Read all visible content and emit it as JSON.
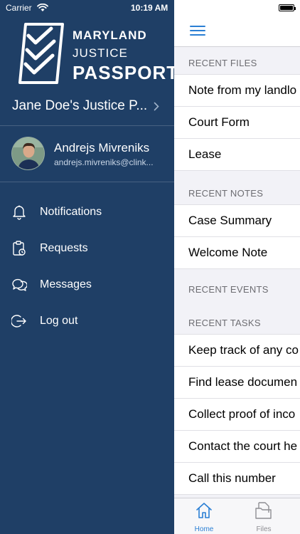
{
  "status_bar": {
    "carrier": "Carrier",
    "time": "10:19 AM"
  },
  "logo": {
    "line1": "MARYLAND",
    "line2": "JUSTICE",
    "line3": "PASSPORT"
  },
  "passport": {
    "name": "Jane Doe's Justice P..."
  },
  "user": {
    "name": "Andrejs Mivreniks",
    "email": "andrejs.mivreniks@clink..."
  },
  "menu": [
    {
      "label": "Notifications",
      "icon": "bell-icon"
    },
    {
      "label": "Requests",
      "icon": "clipboard-clock-icon"
    },
    {
      "label": "Messages",
      "icon": "chat-bubbles-icon"
    },
    {
      "label": "Log out",
      "icon": "logout-icon"
    }
  ],
  "sections": {
    "recent_files": {
      "header": "RECENT FILES",
      "items": [
        "Note from my landlo",
        "Court Form",
        "Lease"
      ]
    },
    "recent_notes": {
      "header": "RECENT NOTES",
      "items": [
        "Case Summary",
        "Welcome Note"
      ]
    },
    "recent_events": {
      "header": "RECENT EVENTS",
      "items": []
    },
    "recent_tasks": {
      "header": "RECENT TASKS",
      "items": [
        "Keep track of any co",
        "Find lease documen",
        "Collect proof of inco",
        "Contact the court he",
        "Call this number"
      ]
    }
  },
  "tabs": [
    {
      "label": "Home",
      "icon": "home-icon",
      "active": true
    },
    {
      "label": "Files",
      "icon": "files-icon",
      "active": false
    }
  ],
  "colors": {
    "drawer_bg": "#1f3f66",
    "accent": "#2a7fd4",
    "inactive_tab": "#8e8e93"
  }
}
